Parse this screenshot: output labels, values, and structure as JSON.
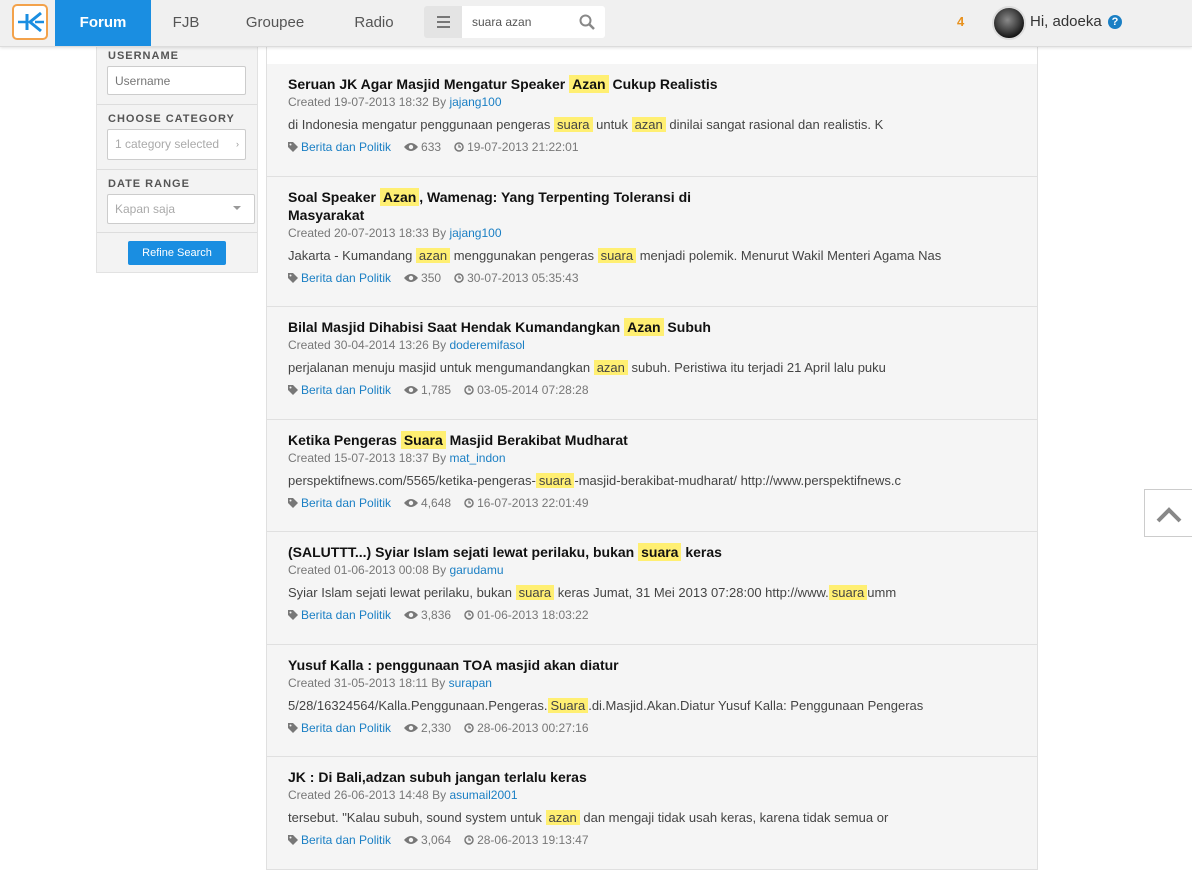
{
  "nav": {
    "tabs": [
      {
        "label": "Forum"
      },
      {
        "label": "FJB"
      },
      {
        "label": "Groupee"
      },
      {
        "label": "Radio"
      }
    ],
    "search_value": "suara azan",
    "notif_count": "4",
    "greeting": "Hi, adoeka",
    "help": "?",
    "accent_color": "#1a8ee1",
    "logo_color": "#f3a24b"
  },
  "sidebar": {
    "username_label": "USERNAME",
    "username_placeholder": "Username",
    "category_label": "CHOOSE CATEGORY",
    "category_value": "1 category selected",
    "date_label": "DATE RANGE",
    "date_value": "Kapan saja",
    "refine_button": "Refine Search"
  },
  "results": [
    {
      "title": [
        {
          "t": "Seruan JK Agar Masjid Mengatur Speaker "
        },
        {
          "t": "Azan",
          "h": true
        },
        {
          "t": " Cukup Realistis"
        }
      ],
      "created": "Created 19-07-2013 18:32 By ",
      "author": "jajang100",
      "snippet": [
        {
          "t": "di Indonesia mengatur penggunaan pengeras "
        },
        {
          "t": "suara",
          "h": true
        },
        {
          "t": " untuk "
        },
        {
          "t": "azan",
          "h": true
        },
        {
          "t": " dinilai sangat rasional dan realistis. K"
        }
      ],
      "category": "Berita dan Politik",
      "views": "633",
      "last": "19-07-2013 21:22:01"
    },
    {
      "title": [
        {
          "t": "Soal Speaker "
        },
        {
          "t": "Azan",
          "h": true
        },
        {
          "t": ", Wamenag: Yang Terpenting Toleransi di Masyarakat"
        }
      ],
      "created": "Created 20-07-2013 18:33 By ",
      "author": "jajang100",
      "snippet": [
        {
          "t": "Jakarta - Kumandang "
        },
        {
          "t": "azan",
          "h": true
        },
        {
          "t": " menggunakan pengeras "
        },
        {
          "t": "suara",
          "h": true
        },
        {
          "t": " menjadi polemik. Menurut Wakil Menteri Agama Nas"
        }
      ],
      "category": "Berita dan Politik",
      "views": "350",
      "last": "30-07-2013 05:35:43"
    },
    {
      "title": [
        {
          "t": "Bilal Masjid Dihabisi Saat Hendak Kumandangkan "
        },
        {
          "t": "Azan",
          "h": true
        },
        {
          "t": " Subuh"
        }
      ],
      "created": "Created 30-04-2014 13:26 By ",
      "author": "doderemifasol",
      "snippet": [
        {
          "t": "perjalanan menuju masjid untuk mengumandangkan "
        },
        {
          "t": "azan",
          "h": true
        },
        {
          "t": " subuh. Peristiwa itu terjadi 21 April lalu puku"
        }
      ],
      "category": "Berita dan Politik",
      "views": "1,785",
      "last": "03-05-2014 07:28:28"
    },
    {
      "title": [
        {
          "t": "Ketika Pengeras "
        },
        {
          "t": "Suara",
          "h": true
        },
        {
          "t": " Masjid Berakibat Mudharat"
        }
      ],
      "created": "Created 15-07-2013 18:37 By ",
      "author": "mat_indon",
      "snippet": [
        {
          "t": "perspektifnews.com/5565/ketika-pengeras-"
        },
        {
          "t": "suara",
          "h": true
        },
        {
          "t": "-masjid-berakibat-mudharat/ http://www.perspektifnews.c"
        }
      ],
      "category": "Berita dan Politik",
      "views": "4,648",
      "last": "16-07-2013 22:01:49"
    },
    {
      "title": [
        {
          "t": "(SALUTTT...) Syiar Islam sejati lewat perilaku, bukan "
        },
        {
          "t": "suara",
          "h": true
        },
        {
          "t": " keras"
        }
      ],
      "created": "Created 01-06-2013 00:08 By ",
      "author": "garudamu",
      "snippet": [
        {
          "t": "Syiar Islam sejati lewat perilaku, bukan "
        },
        {
          "t": "suara",
          "h": true
        },
        {
          "t": " keras Jumat, 31 Mei 2013 07:28:00 http://www."
        },
        {
          "t": "suara",
          "h": true
        },
        {
          "t": "umm"
        }
      ],
      "category": "Berita dan Politik",
      "views": "3,836",
      "last": "01-06-2013 18:03:22"
    },
    {
      "title": [
        {
          "t": "Yusuf Kalla : penggunaan TOA masjid akan diatur"
        }
      ],
      "created": "Created 31-05-2013 18:11 By ",
      "author": "surapan",
      "snippet": [
        {
          "t": "5/28/16324564/Kalla.Penggunaan.Pengeras."
        },
        {
          "t": "Suara",
          "h": true
        },
        {
          "t": ".di.Masjid.Akan.Diatur Yusuf Kalla: Penggunaan Pengeras"
        }
      ],
      "category": "Berita dan Politik",
      "views": "2,330",
      "last": "28-06-2013 00:27:16"
    },
    {
      "title": [
        {
          "t": "JK : Di Bali,adzan subuh jangan terlalu keras"
        }
      ],
      "created": "Created 26-06-2013 14:48 By ",
      "author": "asumail2001",
      "snippet": [
        {
          "t": "tersebut. \"Kalau subuh, sound system untuk "
        },
        {
          "t": "azan",
          "h": true
        },
        {
          "t": " dan mengaji tidak usah keras, karena tidak semua or"
        }
      ],
      "category": "Berita dan Politik",
      "views": "3,064",
      "last": "28-06-2013 19:13:47"
    }
  ]
}
